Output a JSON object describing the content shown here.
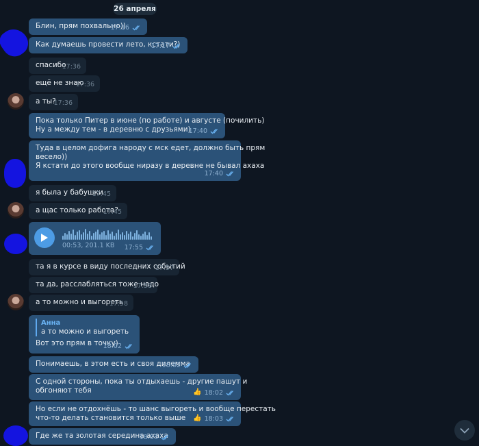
{
  "date_label": "26 апреля",
  "messages": [
    {
      "dir": "out",
      "text": [
        "Блин, прям похвально))"
      ],
      "time": "17:16",
      "read": true
    },
    {
      "dir": "out",
      "text": [
        "Как думаешь провести лето, кстати?)"
      ],
      "time": "17:17",
      "read": true
    },
    {
      "dir": "in",
      "text": [
        "спасибо"
      ],
      "time": "17:36"
    },
    {
      "dir": "in",
      "text": [
        "ещё не знаю"
      ],
      "time": "17:36"
    },
    {
      "dir": "in",
      "text": [
        "а ты?"
      ],
      "time": "17:36"
    },
    {
      "dir": "out",
      "text": [
        "Пока только Питер в июне (по работе) и августе (почилить)",
        "Ну а между тем - в деревню с друзьями)"
      ],
      "time": "17:40",
      "read": true
    },
    {
      "dir": "out",
      "text": [
        "Туда в целом дофига народу с мск едет, должно быть прям",
        "весело))",
        "Я кстати до этого вообще ниразу в деревне не бывал ахаха"
      ],
      "time": "17:40",
      "read": true
    },
    {
      "dir": "in",
      "text": [
        "я была у бабушки"
      ],
      "time": "17:45"
    },
    {
      "dir": "in",
      "text": [
        "а щас только работа?"
      ],
      "time": "17:45"
    },
    {
      "dir": "out",
      "voice": {
        "duration": "00:53, 201.1 KB"
      },
      "time": "17:55",
      "read": true
    },
    {
      "dir": "in",
      "text": [
        "та я в курсе в виду последних событий"
      ],
      "time": "17:57"
    },
    {
      "dir": "in",
      "text": [
        "та да, расслабляться тоже надо"
      ],
      "time": "17:58"
    },
    {
      "dir": "in",
      "text": [
        "а то можно и выгореть"
      ],
      "time": "17:58"
    },
    {
      "dir": "out",
      "reply": {
        "name": "Анна",
        "text": "а то можно и выгореть"
      },
      "text": [
        "Вот это прям в точку)"
      ],
      "time": "18:02",
      "read": true
    },
    {
      "dir": "out",
      "text": [
        "Понимаешь, в этом есть и своя дилемма"
      ],
      "time": "18:02",
      "read": true
    },
    {
      "dir": "out",
      "text": [
        "С одной стороны, пока ты отдыхаешь - другие пашут и",
        "обгоняют тебя"
      ],
      "time": "18:02",
      "read": true,
      "reaction": "👍"
    },
    {
      "dir": "out",
      "text": [
        "Но если не отдохнёшь - то шанс выгореть и вообще перестать",
        "что-то делать становится только выше"
      ],
      "time": "18:03",
      "read": true,
      "reaction": "👍"
    },
    {
      "dir": "out",
      "text": [
        "Где же та золотая середина ахаха"
      ],
      "time": "18:03",
      "read": true
    }
  ]
}
